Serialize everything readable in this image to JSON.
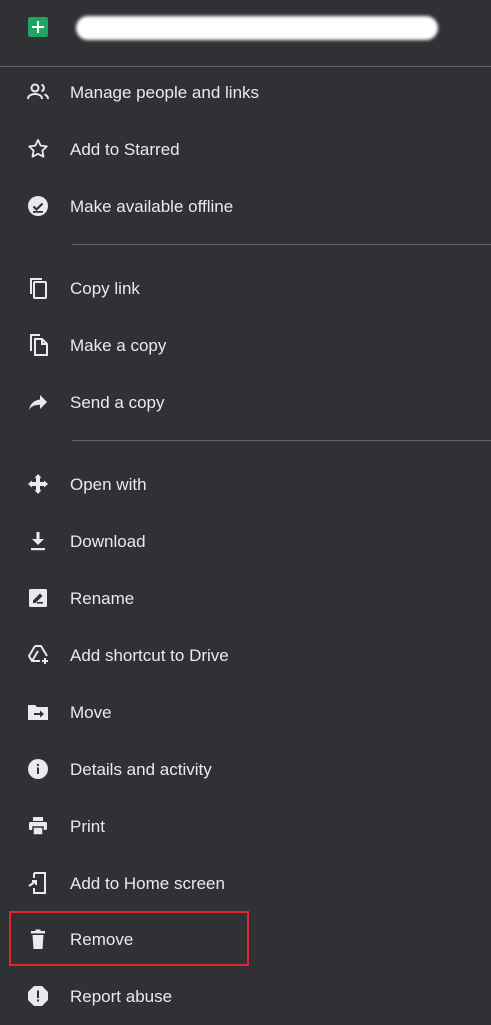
{
  "header": {
    "file_icon": "google-sheets-icon",
    "file_name_redacted": true
  },
  "menu": {
    "items": [
      {
        "label": "Manage people and links",
        "icon": "people-icon"
      },
      {
        "label": "Add to Starred",
        "icon": "star-outline-icon"
      },
      {
        "label": "Make available offline",
        "icon": "offline-check-icon"
      },
      {
        "label": "Copy link",
        "icon": "copy-icon"
      },
      {
        "label": "Make a copy",
        "icon": "file-copy-icon"
      },
      {
        "label": "Send a copy",
        "icon": "share-arrow-icon"
      },
      {
        "label": "Open with",
        "icon": "open-with-icon"
      },
      {
        "label": "Download",
        "icon": "download-icon"
      },
      {
        "label": "Rename",
        "icon": "rename-icon"
      },
      {
        "label": "Add shortcut to Drive",
        "icon": "add-shortcut-icon"
      },
      {
        "label": "Move",
        "icon": "move-folder-icon"
      },
      {
        "label": "Details and activity",
        "icon": "info-icon"
      },
      {
        "label": "Print",
        "icon": "printer-icon"
      },
      {
        "label": "Add to Home screen",
        "icon": "add-to-home-icon"
      },
      {
        "label": "Remove",
        "icon": "trash-icon"
      },
      {
        "label": "Report abuse",
        "icon": "report-icon"
      }
    ]
  },
  "colors": {
    "background": "#303134",
    "text": "#e8eaed",
    "divider": "#5f6368",
    "highlight_border": "#e0252c",
    "sheets_green": "#1fa463"
  }
}
